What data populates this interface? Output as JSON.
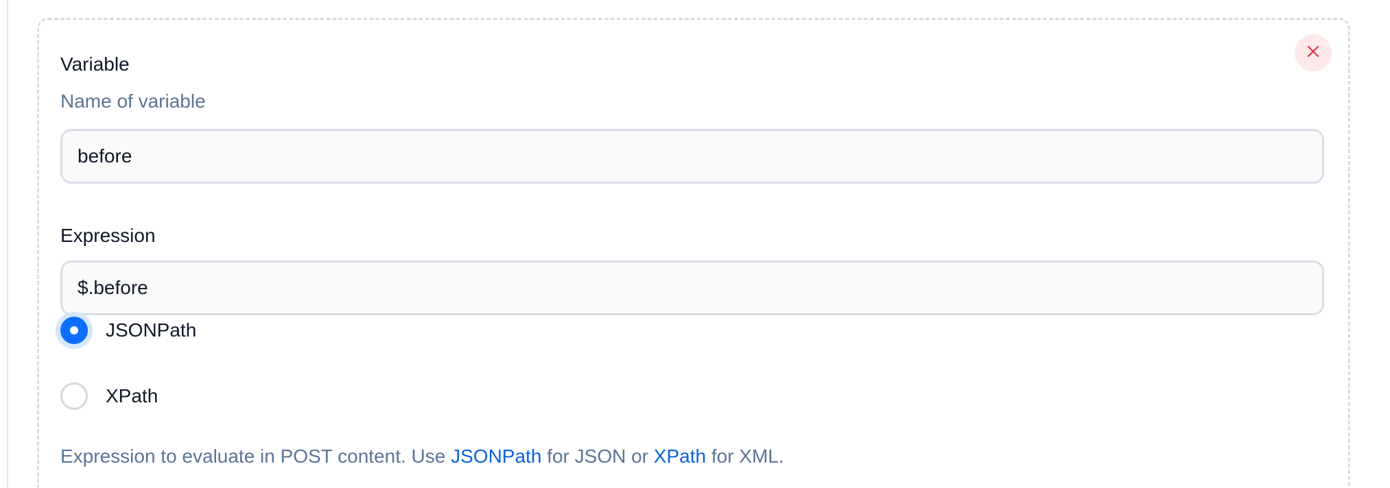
{
  "form": {
    "variable_label": "Variable",
    "variable_hint": "Name of variable",
    "variable_value": "before",
    "expression_label": "Expression",
    "expression_value": "$.before",
    "radio_options": [
      {
        "label": "JSONPath",
        "checked": true
      },
      {
        "label": "XPath",
        "checked": false
      }
    ],
    "help_text": {
      "prefix": "Expression to evaluate in POST content. Use ",
      "link1": "JSONPath",
      "middle": " for JSON or ",
      "link2": "XPath",
      "suffix": " for XML."
    },
    "close_icon": "close-icon"
  },
  "colors": {
    "accent": "#0d6efd",
    "link": "#0b62d8",
    "hint": "#5a7595",
    "close_bg": "#fde8ea",
    "close_icon": "#d63a4a",
    "dashed_border": "#d7dde6"
  }
}
